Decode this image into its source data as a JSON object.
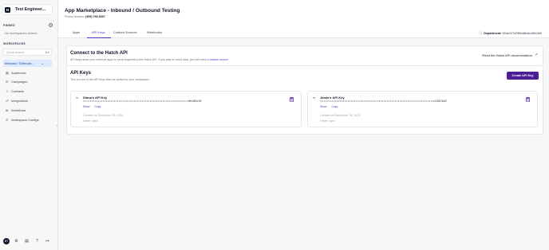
{
  "sidebar": {
    "logo": "H",
    "workspace_name": "Test Engineer...",
    "pinned_label": "PINNED",
    "no_pinned": "No workspaces pinned",
    "workspaces_label": "WORKSPACES",
    "search_placeholder": "Quick search...",
    "search_shortcut": "⌘K",
    "active_workspace": "Inbound / Outboun...",
    "nav": [
      {
        "label": "Audiences",
        "icon": "audiences-icon"
      },
      {
        "label": "Campaigns",
        "icon": "campaigns-icon"
      },
      {
        "label": "Contacts",
        "icon": "contacts-icon"
      },
      {
        "label": "Integrations",
        "icon": "integrations-icon"
      },
      {
        "label": "Workflows",
        "icon": "workflows-icon"
      },
      {
        "label": "Workspace Configs",
        "icon": "settings-icon"
      }
    ],
    "avatar_initials": "BT"
  },
  "header": {
    "title": "App Marketplace - Inbound / Outbound Testing",
    "phone_label": "Phone Number:",
    "phone_value": "(405) 794-6667"
  },
  "tabs": [
    "Apps",
    "API Keys",
    "Custom Sources",
    "Webhooks"
  ],
  "active_tab": "API Keys",
  "department": {
    "label": "Department:",
    "value": "60de247d0f5b48bdec66b369"
  },
  "connect": {
    "title": "Connect to the Hatch API",
    "desc": "API keys allow your external apps to send requests to the Hatch API. If you plan to send data, you will need a",
    "link": "custom source",
    "docs_link": "Read the Hatch API documentation"
  },
  "api_keys": {
    "title": "API Keys",
    "subtitle": "This is a list of the API keys that are active for your workspace.",
    "create_button": "Create API Key",
    "keys": [
      {
        "name": "Diana's API Key",
        "masked": "•••••••••••••••••••••••••••••••••••••••••••••••••••••••••••••••••0e185c20",
        "show": "Show",
        "copy": "Copy",
        "created": "Created on December 26, 2024",
        "used": "Never used"
      },
      {
        "name": "Jamie's API Key",
        "masked": "••••••••••••••••••••••••••••••••••••••••••••••••••••••••••••••••••••••c1387a22",
        "show": "Show",
        "copy": "Copy",
        "created": "Created on December 26, 2024",
        "used": "Never used"
      }
    ]
  },
  "colors": {
    "accent": "#4338ca",
    "button": "#4c1d95",
    "active_workspace_bg": "#dbeafe"
  }
}
